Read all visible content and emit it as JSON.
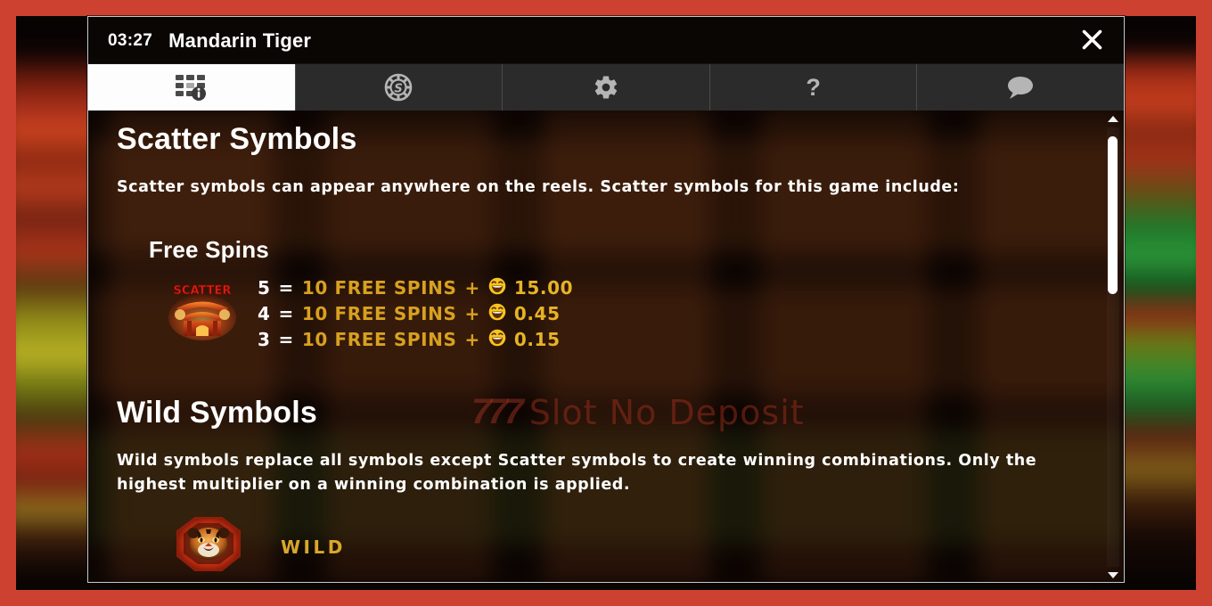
{
  "window": {
    "clock": "03:27",
    "game_title": "Mandarin Tiger",
    "close_label": "close-icon",
    "border_color": "#cc4130",
    "panel_bg": "#0d0604"
  },
  "tabs": [
    {
      "id": "paytable",
      "icon": "paytable-info-icon",
      "label": "Paytable",
      "active": true
    },
    {
      "id": "bet",
      "icon": "casino-chip-dollar-icon",
      "label": "Bet",
      "active": false
    },
    {
      "id": "settings",
      "icon": "gear-icon",
      "label": "Settings",
      "active": false
    },
    {
      "id": "help",
      "icon": "question-mark-icon",
      "label": "Help",
      "active": false,
      "glyph": "?"
    },
    {
      "id": "chat",
      "icon": "chat-bubble-icon",
      "label": "Chat",
      "active": false
    }
  ],
  "content": {
    "scatter": {
      "title": "Scatter Symbols",
      "description": "Scatter symbols can appear anywhere on the reels. Scatter symbols for this game include:",
      "free_spins": {
        "title": "Free Spins",
        "symbol_icon": "scatter-temple-symbol",
        "symbol_label": "SCATTER",
        "paylines": [
          {
            "count": "5",
            "equals": "=",
            "award": "10 FREE SPINS",
            "plus": "+",
            "coin": "grinning-face-icon",
            "amount": "15.00"
          },
          {
            "count": "4",
            "equals": "=",
            "award": "10 FREE SPINS",
            "plus": "+",
            "coin": "grinning-face-icon",
            "amount": "0.45"
          },
          {
            "count": "3",
            "equals": "=",
            "award": "10 FREE SPINS",
            "plus": "+",
            "coin": "grinning-face-icon",
            "amount": "0.15"
          }
        ]
      }
    },
    "wild": {
      "title": "Wild Symbols",
      "description": "Wild symbols replace all symbols except Scatter symbols to create winning combinations. Only the highest multiplier on a winning combination is applied.",
      "symbol_icon": "wild-tiger-symbol",
      "symbol_label": "WILD"
    },
    "watermark": {
      "logo": "777",
      "text": "Slot No Deposit"
    },
    "colors": {
      "award_gold": "#d8a11f",
      "amount_gold": "#e7b325",
      "wild_gold": "#d9a72b",
      "text_white": "#ffffff"
    }
  },
  "scrollbar": {
    "up_arrow": "scroll-up-arrow",
    "down_arrow": "scroll-down-arrow",
    "thumb_position_percent": 2,
    "thumb_size_percent": 36
  }
}
